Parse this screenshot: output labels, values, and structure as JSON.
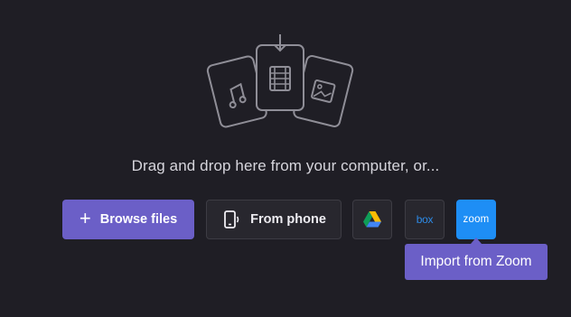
{
  "upload": {
    "prompt": "Drag and drop here from your computer, or...",
    "browse_label": "Browse files",
    "phone_label": "From phone",
    "box_label": "box",
    "zoom_label": "zoom",
    "tooltip": "Import from Zoom"
  },
  "icons": {
    "illustration": "media-cards-with-download-arrow",
    "plus": "plus-icon",
    "phone": "phone-icon",
    "gdrive": "google-drive-icon",
    "box": "box-logo",
    "zoom": "zoom-logo"
  },
  "colors": {
    "background": "#1f1e25",
    "accent": "#6b5fc7",
    "zoom_blue": "#1e8ef5",
    "box_blue": "#2d8ae5"
  }
}
